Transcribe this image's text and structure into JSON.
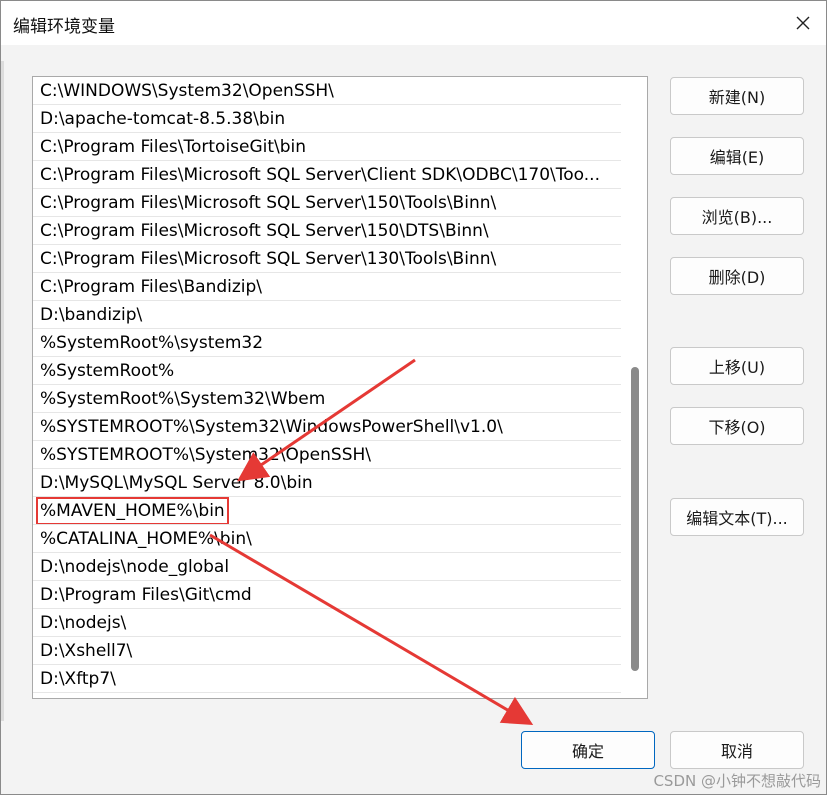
{
  "window": {
    "title": "编辑环境变量"
  },
  "path_list": {
    "items": [
      "C:\\WINDOWS\\System32\\OpenSSH\\",
      "D:\\apache-tomcat-8.5.38\\bin",
      "C:\\Program Files\\TortoiseGit\\bin",
      "C:\\Program Files\\Microsoft SQL Server\\Client SDK\\ODBC\\170\\Too...",
      "C:\\Program Files\\Microsoft SQL Server\\150\\Tools\\Binn\\",
      "C:\\Program Files\\Microsoft SQL Server\\150\\DTS\\Binn\\",
      "C:\\Program Files\\Microsoft SQL Server\\130\\Tools\\Binn\\",
      "C:\\Program Files\\Bandizip\\",
      "D:\\bandizip\\",
      "%SystemRoot%\\system32",
      "%SystemRoot%",
      "%SystemRoot%\\System32\\Wbem",
      "%SYSTEMROOT%\\System32\\WindowsPowerShell\\v1.0\\",
      "%SYSTEMROOT%\\System32\\OpenSSH\\",
      "D:\\MySQL\\MySQL Server 8.0\\bin",
      "%MAVEN_HOME%\\bin",
      "%CATALINA_HOME%\\bin\\",
      "D:\\nodejs\\node_global",
      "D:\\Program Files\\Git\\cmd",
      "D:\\nodejs\\",
      "D:\\Xshell7\\",
      "D:\\Xftp7\\"
    ],
    "highlighted_index": 15
  },
  "buttons": {
    "new": "新建(N)",
    "edit": "编辑(E)",
    "browse": "浏览(B)...",
    "delete": "删除(D)",
    "move_up": "上移(U)",
    "move_down": "下移(O)",
    "edit_text": "编辑文本(T)...",
    "ok": "确定",
    "cancel": "取消"
  },
  "watermark": "CSDN @小钟不想敲代码",
  "colors": {
    "annotation": "#e53935",
    "primary_border": "#0067c0"
  }
}
